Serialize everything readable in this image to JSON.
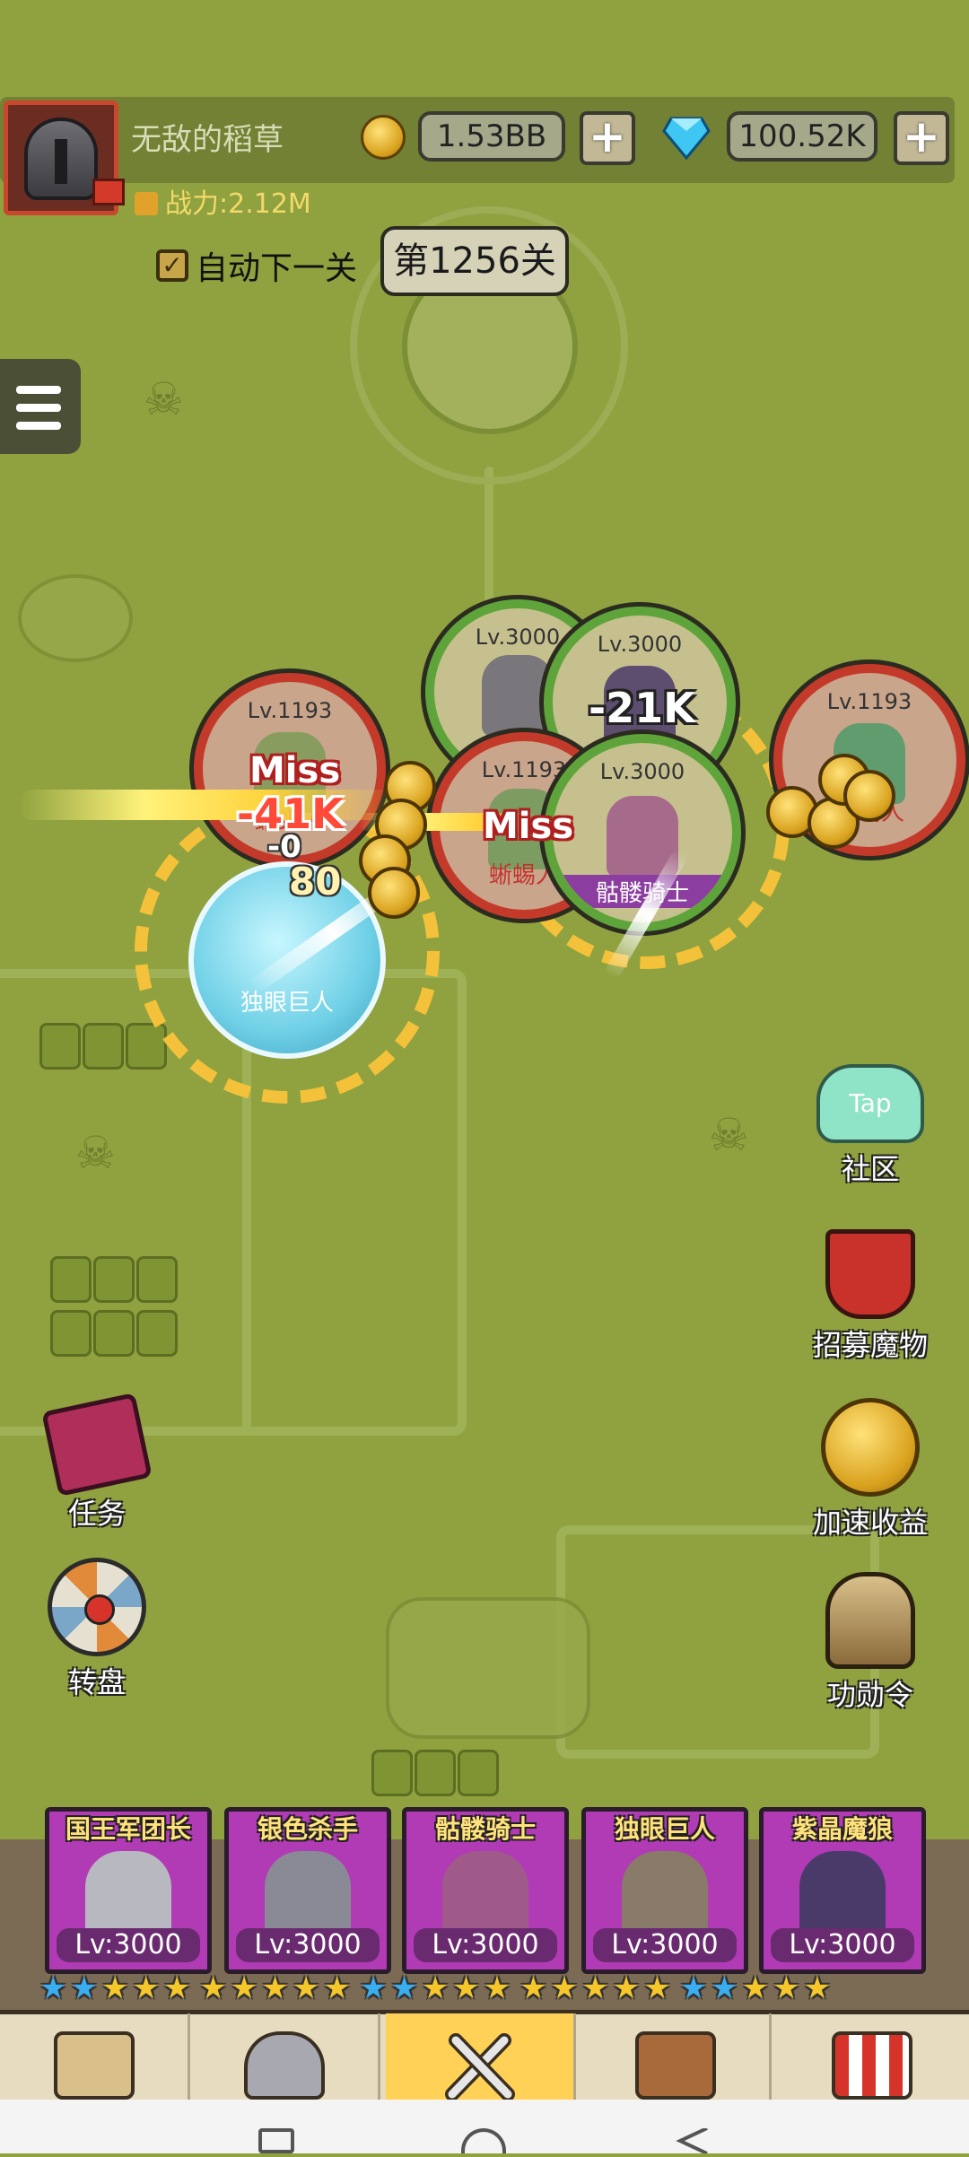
{
  "player": {
    "name": "无敌的稻草",
    "power_label": "战力:2.12M",
    "gold": "1.53BB",
    "gems": "100.52K",
    "plus_label": "+"
  },
  "battle": {
    "auto_next_label": "自动下一关",
    "auto_next_checked": true,
    "checkmark": "✓",
    "stage_label": "第1256关"
  },
  "units": {
    "enemy_left": {
      "level": "Lv.1193",
      "name": "蜥蜴人"
    },
    "enemy_center": {
      "level": "Lv.1193",
      "name": "蜥蜴人"
    },
    "enemy_right": {
      "level": "Lv.1193",
      "name": "蜥蜴人"
    },
    "ally_top_left": {
      "level": "Lv.3000"
    },
    "ally_top_right": {
      "level": "Lv.3000"
    },
    "ally_center": {
      "level": "Lv.3000",
      "name": "骷髅骑士"
    },
    "ally_shield_name": "独眼巨人"
  },
  "combat_text": {
    "miss_1": "Miss",
    "dmg_1": "-41K",
    "miss_2": "Miss",
    "dmg_2": "-21K",
    "zero": "-0",
    "partial": "80"
  },
  "side_buttons": {
    "community": {
      "icon_text": "Tap",
      "label": "社区"
    },
    "recruit": {
      "label": "招募魔物"
    },
    "boost": {
      "label": "加速收益"
    },
    "task": {
      "label": "任务"
    },
    "wheel": {
      "label": "转盘"
    },
    "merit": {
      "label": "功勋令"
    }
  },
  "heroes": [
    {
      "name": "国王军团长",
      "level": "Lv:3000",
      "stars": "★★★★★",
      "blue_stars": 2
    },
    {
      "name": "银色杀手",
      "level": "Lv:3000",
      "stars": "★★★★★",
      "blue_stars": 0
    },
    {
      "name": "骷髅骑士",
      "level": "Lv:3000",
      "stars": "★★★★★",
      "blue_stars": 2
    },
    {
      "name": "独眼巨人",
      "level": "Lv:3000",
      "stars": "★★★★★",
      "blue_stars": 0
    },
    {
      "name": "紫晶魔狼",
      "level": "Lv:3000",
      "stars": "★★★★★",
      "blue_stars": 2
    }
  ],
  "tabs": [
    {
      "icon": "map-icon",
      "active": false
    },
    {
      "icon": "helmet-icon",
      "active": false
    },
    {
      "icon": "crossed-swords-icon",
      "active": true
    },
    {
      "icon": "robot-icon",
      "active": false
    },
    {
      "icon": "shop-icon",
      "active": false
    }
  ],
  "colors": {
    "map_green": "#8fa23f",
    "enemy_ring": "#c33a2a",
    "ally_ring": "#5fa43a",
    "hero_card": "#b13ab5",
    "active_tab": "#ffd257"
  }
}
